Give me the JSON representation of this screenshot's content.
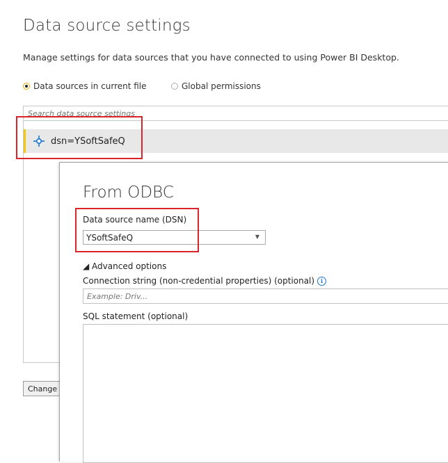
{
  "page": {
    "title": "Data source settings",
    "subtitle": "Manage settings for data sources that you have connected to using Power BI Desktop."
  },
  "scope": {
    "options": [
      {
        "label": "Data sources in current file",
        "selected": true
      },
      {
        "label": "Global permissions",
        "selected": false
      }
    ]
  },
  "search": {
    "placeholder": "Search data source settings"
  },
  "sources": {
    "items": [
      {
        "label": "dsn=YSoftSafeQ",
        "icon": "odbc-connector-icon"
      }
    ]
  },
  "buttons": {
    "change_label": "Change"
  },
  "dialog": {
    "title": "From ODBC",
    "dsn_label": "Data source name (DSN)",
    "dsn_value": "YSoftSafeQ",
    "advanced_label": "◢ Advanced options",
    "conn_label": "Connection string (non-credential properties) (optional)",
    "conn_placeholder": "Example: Driv...",
    "sql_label": "SQL statement (optional)",
    "info_glyph": "i"
  },
  "colors": {
    "accent": "#f2c811",
    "highlight": "#d9242c",
    "icon": "#1a75cf"
  }
}
